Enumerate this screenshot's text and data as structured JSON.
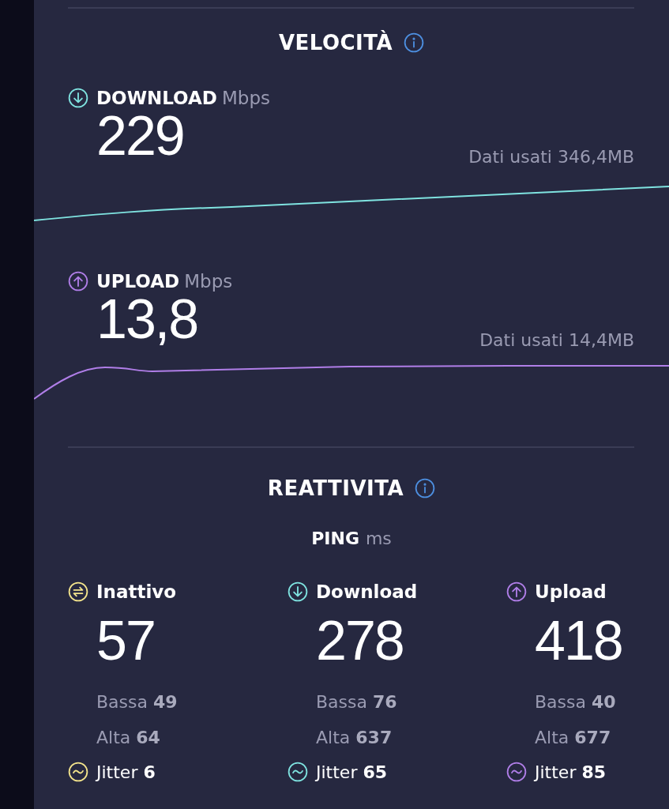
{
  "speed": {
    "title": "VELOCITÀ",
    "metrics": [
      {
        "kind": "download",
        "label": "DOWNLOAD",
        "unit": "Mbps",
        "value": "229",
        "data_used": "Dati usati 346,4MB",
        "color": "#7fe3e0"
      },
      {
        "kind": "upload",
        "label": "UPLOAD",
        "unit": "Mbps",
        "value": "13,8",
        "data_used": "Dati usati 14,4MB",
        "color": "#b07ee8"
      }
    ]
  },
  "responsiveness": {
    "title": "REATTIVITA",
    "ping": {
      "label": "PING",
      "unit": "ms"
    },
    "columns": [
      {
        "kind": "idle",
        "label": "Inattivo",
        "value": "57",
        "low": "Bassa **49**",
        "high": "Alta **64**",
        "jitter": "Jitter **6**",
        "color": "#f3e48c"
      },
      {
        "kind": "download",
        "label": "Download",
        "value": "278",
        "low": "Bassa **76**",
        "high": "Alta **637**",
        "jitter": "Jitter **65**",
        "color": "#7fe3e0"
      },
      {
        "kind": "upload",
        "label": "Upload",
        "value": "418",
        "low": "Bassa **40**",
        "high": "Alta **677**",
        "jitter": "Jitter **85**",
        "color": "#b07ee8"
      }
    ]
  }
}
